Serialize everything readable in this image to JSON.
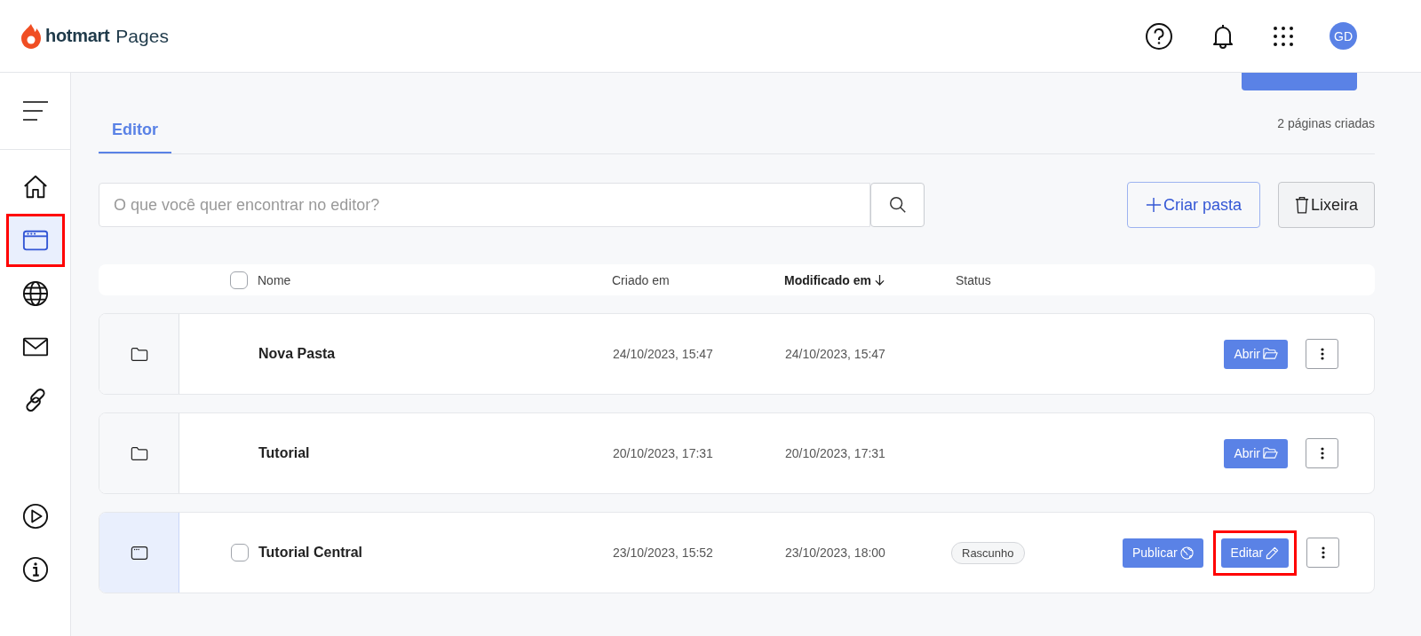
{
  "app": {
    "brand": "hotmart",
    "product": "Pages"
  },
  "header": {
    "avatar": "GD"
  },
  "sidebar": {
    "items": [
      {
        "kind": "home",
        "selected": false,
        "highlighted": false
      },
      {
        "kind": "pages",
        "selected": true,
        "highlighted": true
      },
      {
        "kind": "globe",
        "selected": false,
        "highlighted": false
      },
      {
        "kind": "mail",
        "selected": false,
        "highlighted": false
      },
      {
        "kind": "link",
        "selected": false,
        "highlighted": false
      }
    ],
    "bottom_items": [
      {
        "kind": "play"
      },
      {
        "kind": "info"
      }
    ]
  },
  "page": {
    "create_button": {
      "kind": "primary"
    }
  },
  "tabs": [
    {
      "label": "Editor",
      "selected": true
    }
  ],
  "count": "2 páginas criadas",
  "search": {
    "placeholder": "O que você quer encontrar no editor?"
  },
  "buttons": {
    "create_folder": "Criar pasta",
    "trash": "Lixeira"
  },
  "table": {
    "select_all": {
      "checked": false
    },
    "columns": [
      {
        "label": "Nome",
        "sorted": false
      },
      {
        "label": "Criado em",
        "sorted": false
      },
      {
        "label": "Modificado em",
        "sorted": true
      },
      {
        "label": "Status",
        "sorted": false
      }
    ],
    "rows": [
      {
        "kind": "folder",
        "hovered": false,
        "name": "Nova Pasta",
        "created": "24/10/2023, 15:47",
        "modified": "24/10/2023, 15:47",
        "actions": [
          {
            "kind": "open",
            "label": "Abrir",
            "highlighted": false
          }
        ]
      },
      {
        "kind": "folder",
        "hovered": false,
        "name": "Tutorial",
        "created": "20/10/2023, 17:31",
        "modified": "20/10/2023, 17:31",
        "actions": [
          {
            "kind": "open",
            "label": "Abrir",
            "highlighted": false
          }
        ]
      },
      {
        "kind": "page",
        "hovered": true,
        "checked": false,
        "name": "Tutorial Central",
        "created": "23/10/2023, 15:52",
        "modified": "23/10/2023, 18:00",
        "status": "Rascunho",
        "actions": [
          {
            "kind": "publish",
            "label": "Publicar",
            "highlighted": false
          },
          {
            "kind": "edit",
            "label": "Editar",
            "highlighted": true
          }
        ]
      }
    ]
  }
}
